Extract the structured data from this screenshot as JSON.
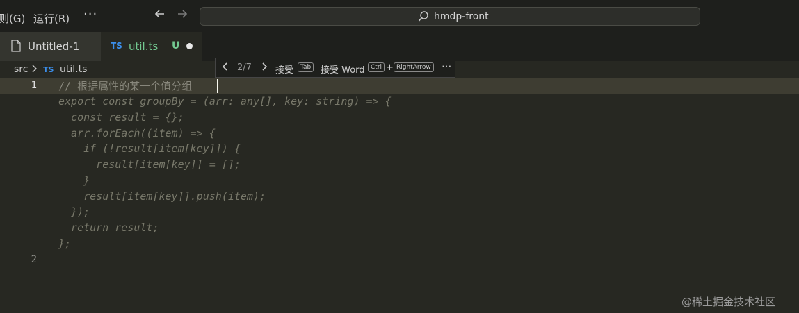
{
  "titlebar": {
    "menu": [
      "则(G)",
      "运行(R)"
    ],
    "more": "···",
    "search": "hmdp-front"
  },
  "tabs": [
    {
      "label": "Untitled-1"
    },
    {
      "label": "util.ts",
      "icon_text": "TS",
      "status": "U"
    }
  ],
  "breadcrumb": {
    "folder": "src",
    "icon_text": "TS",
    "file": "util.ts"
  },
  "hint_toolbar": {
    "counter": "2/7",
    "accept": "接受",
    "accept_key": "Tab",
    "accept_word": "接受 Word",
    "key_ctrl": "Ctrl",
    "plus": "+",
    "key_arrow": "RightArrow",
    "more": "···"
  },
  "editor": {
    "line_numbers": [
      "1",
      "2"
    ],
    "comment": "// 根据属性的某一个值分组",
    "ghost_lines": [
      "export const groupBy = (arr: any[], key: string) => {",
      "  const result = {};",
      "  arr.forEach((item) => {",
      "    if (!result[item[key]]) {",
      "      result[item[key]] = [];",
      "    }",
      "    result[item[key]].push(item);",
      "  });",
      "  return result;",
      "};"
    ]
  },
  "watermark": "@稀土掘金技术社区",
  "colors": {
    "background": "#272822",
    "ghost_text": "#78786a",
    "ts_blue": "#3b8eea",
    "untracked_green": "#73c991"
  }
}
